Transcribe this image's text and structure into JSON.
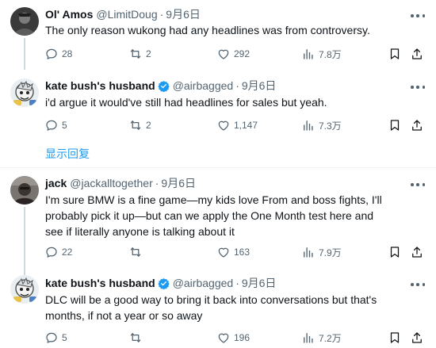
{
  "tweets": [
    {
      "name": "Ol' Amos",
      "handle": "@LimitDoug",
      "time": "9月6日",
      "text": "The only reason wukong had any headlines was from controversy.",
      "replies": "28",
      "retweets": "2",
      "likes": "292",
      "views": "7.8万",
      "verified": false
    },
    {
      "name": "kate bush's husband",
      "handle": "@airbagged",
      "time": "9月6日",
      "text": "i'd argue it would've still had headlines for sales but yeah.",
      "replies": "5",
      "retweets": "2",
      "likes": "1,147",
      "views": "7.3万",
      "verified": true
    },
    {
      "name": "jack",
      "handle": "@jackalltogether",
      "time": "9月6日",
      "text": "I'm sure BMW is a fine game—my kids love From and boss fights, I'll probably pick it up—but can we apply the One Month test here and see if literally anyone is talking about it",
      "replies": "22",
      "retweets": "",
      "likes": "163",
      "views": "7.9万",
      "verified": false
    },
    {
      "name": "kate bush's husband",
      "handle": "@airbagged",
      "time": "9月6日",
      "text": "DLC will be a good way to bring it back into conversations but that's months, if not a year or so away",
      "replies": "5",
      "retweets": "",
      "likes": "196",
      "views": "7.2万",
      "verified": true
    }
  ],
  "show_replies_label": "显示回复",
  "colors": {
    "accent": "#1d9bf0",
    "secondary_text": "#536471",
    "thread_line": "#cfd9de"
  },
  "icons": [
    "more-icon",
    "reply-icon",
    "retweet-icon",
    "like-icon",
    "views-icon",
    "bookmark-icon",
    "share-icon",
    "verified-badge-icon"
  ]
}
